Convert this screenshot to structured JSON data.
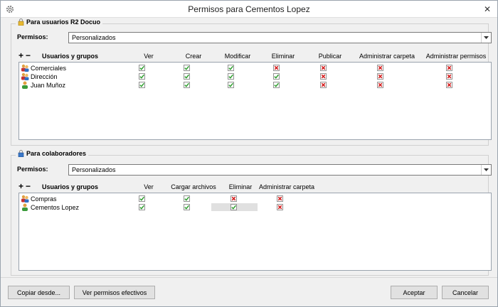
{
  "window": {
    "title": "Permisos para Cementos Lopez",
    "close_glyph": "✕"
  },
  "section_users": {
    "title": "Para usuarios R2 Docuo",
    "permisos_label": "Permisos:",
    "permisos_value": "Personalizados",
    "header_label": "Usuarios y grupos",
    "add_glyph": "+",
    "remove_glyph": "−",
    "columns": [
      "Ver",
      "Crear",
      "Modificar",
      "Eliminar",
      "Publicar",
      "Administrar carpeta",
      "Administrar permisos"
    ],
    "rows": [
      {
        "name": "Comerciales",
        "type": "group",
        "perms": [
          true,
          true,
          true,
          false,
          false,
          false,
          false
        ]
      },
      {
        "name": "Dirección",
        "type": "group",
        "perms": [
          true,
          true,
          true,
          true,
          false,
          false,
          false
        ]
      },
      {
        "name": "Juan Muñoz",
        "type": "user",
        "perms": [
          true,
          true,
          true,
          true,
          false,
          false,
          false
        ]
      }
    ]
  },
  "section_collab": {
    "title": "Para colaboradores",
    "permisos_label": "Permisos:",
    "permisos_value": "Personalizados",
    "header_label": "Usuarios y grupos",
    "add_glyph": "+",
    "remove_glyph": "−",
    "columns": [
      "Ver",
      "Cargar archivos",
      "Eliminar",
      "Administrar carpeta"
    ],
    "rows": [
      {
        "name": "Compras",
        "type": "group",
        "perms": [
          true,
          true,
          false,
          false
        ]
      },
      {
        "name": "Cementos Lopez",
        "type": "user",
        "perms": [
          true,
          true,
          true,
          false
        ]
      }
    ]
  },
  "buttons": {
    "copy": "Copiar desde...",
    "effective": "Ver permisos efectivos",
    "accept": "Aceptar",
    "cancel": "Cancelar"
  },
  "colors": {
    "check_green": "#2e9e2e",
    "cross_red": "#d42020"
  }
}
